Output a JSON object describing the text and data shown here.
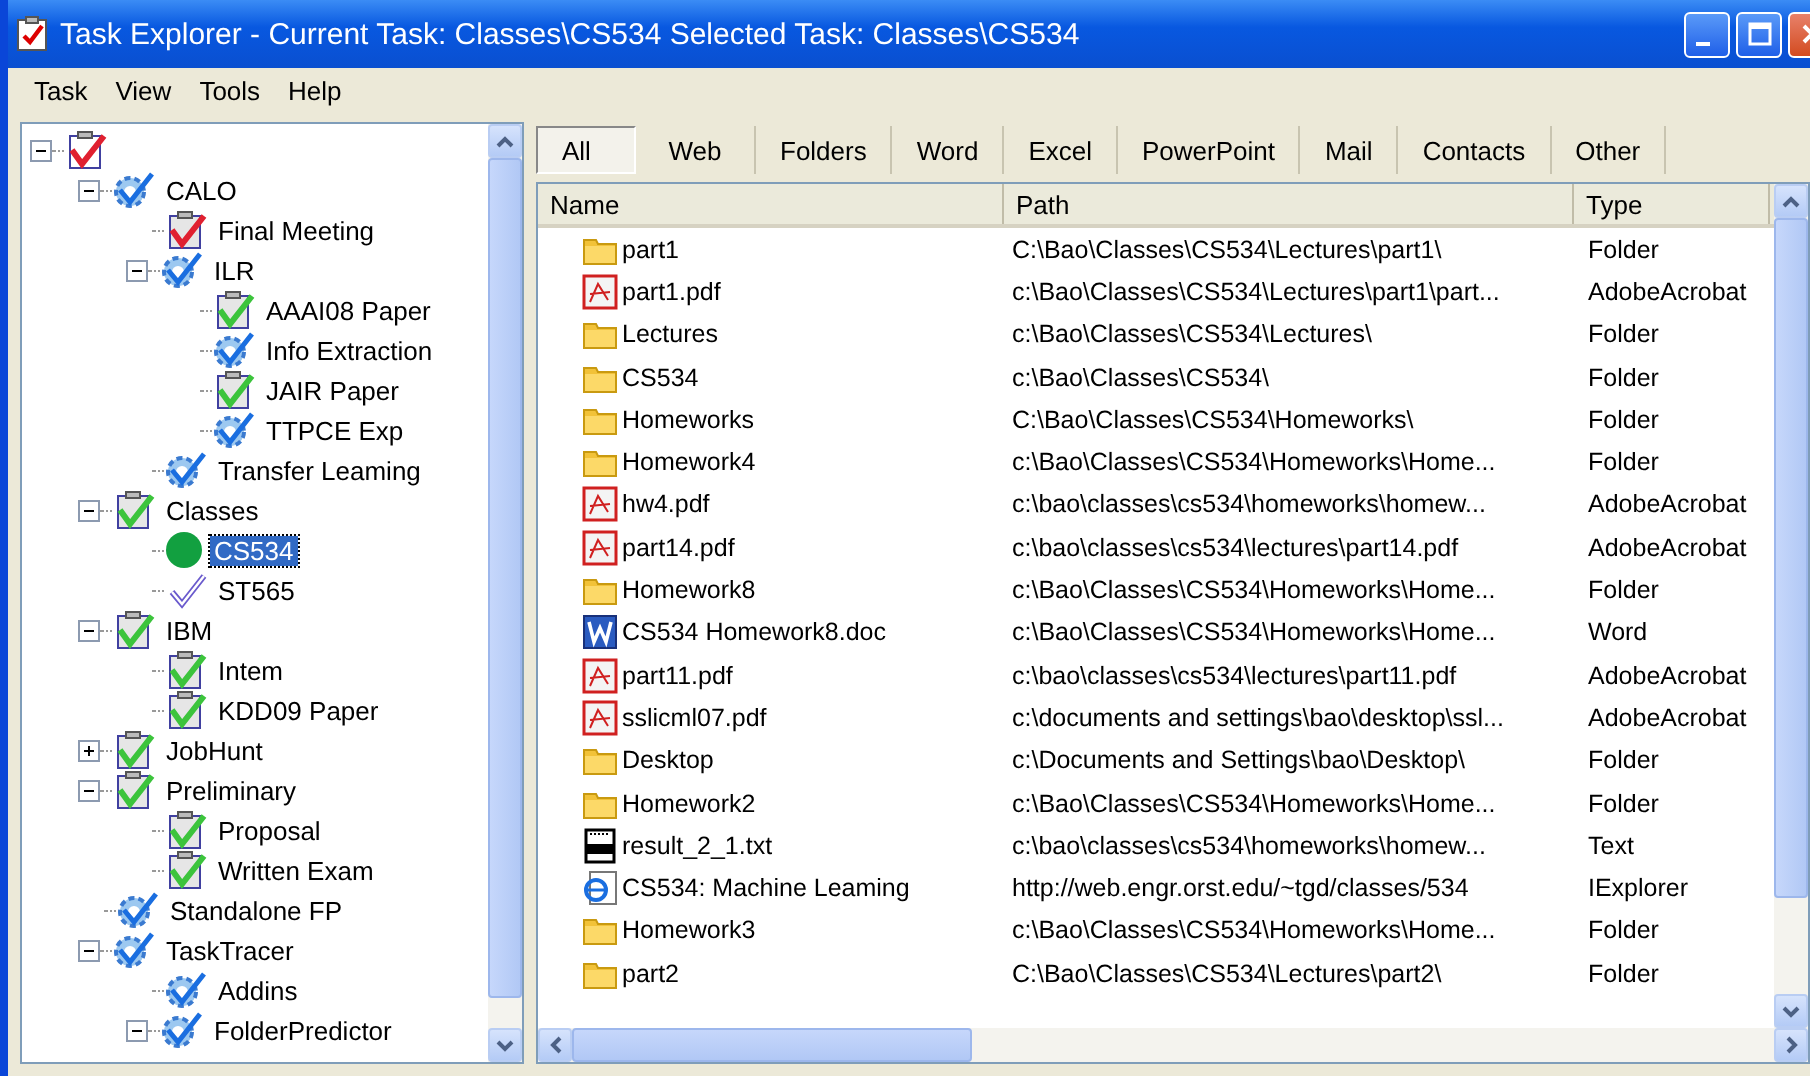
{
  "window": {
    "title": "Task Explorer - Current Task: Classes\\CS534  Selected Task: Classes\\CS534"
  },
  "menu": [
    "Task",
    "View",
    "Tools",
    "Help"
  ],
  "tree": [
    {
      "kind": "root",
      "expanded": true,
      "children": [
        {
          "label": "CALO",
          "kind": "gear",
          "expanded": true,
          "selected": false,
          "children": [
            {
              "label": "Final Meeting",
              "kind": "red-check",
              "selected": false
            },
            {
              "label": "ILR",
              "kind": "gear",
              "expanded": true,
              "selected": false,
              "children": [
                {
                  "label": "AAAI08 Paper",
                  "kind": "green-check",
                  "selected": false
                },
                {
                  "label": "Info Extraction",
                  "kind": "gear",
                  "selected": false
                },
                {
                  "label": "JAIR Paper",
                  "kind": "green-check",
                  "selected": false
                },
                {
                  "label": "TTPCE Exp",
                  "kind": "gear",
                  "selected": false
                }
              ]
            },
            {
              "label": "Transfer Leaming",
              "kind": "gear",
              "selected": false
            }
          ]
        },
        {
          "label": "Classes",
          "kind": "green-check",
          "expanded": true,
          "selected": false,
          "children": [
            {
              "label": "CS534",
              "kind": "dot",
              "selected": true
            },
            {
              "label": "ST565",
              "kind": "outline-check",
              "selected": false
            }
          ]
        },
        {
          "label": "IBM",
          "kind": "green-check",
          "expanded": true,
          "selected": false,
          "children": [
            {
              "label": "Intem",
              "kind": "green-check",
              "selected": false
            },
            {
              "label": "KDD09 Paper",
              "kind": "green-check",
              "selected": false
            }
          ]
        },
        {
          "label": "JobHunt",
          "kind": "green-check",
          "expanded": false,
          "selected": false
        },
        {
          "label": "Preliminary",
          "kind": "green-check",
          "expanded": true,
          "selected": false,
          "children": [
            {
              "label": "Proposal",
              "kind": "green-check",
              "selected": false
            },
            {
              "label": "Written Exam",
              "kind": "green-check",
              "selected": false
            }
          ]
        },
        {
          "label": "Standalone FP",
          "kind": "gear",
          "selected": false
        },
        {
          "label": "TaskTracer",
          "kind": "gear",
          "expanded": true,
          "selected": false,
          "children": [
            {
              "label": "Addins",
              "kind": "gear",
              "selected": false
            },
            {
              "label": "FolderPredictor",
              "kind": "gear",
              "expanded": true,
              "selected": false
            }
          ]
        }
      ]
    }
  ],
  "tabs": [
    {
      "label": "All",
      "selected": true
    },
    {
      "label": "Web",
      "selected": false
    },
    {
      "label": "Folders",
      "selected": false
    },
    {
      "label": "Word",
      "selected": false
    },
    {
      "label": "Excel",
      "selected": false
    },
    {
      "label": "PowerPoint",
      "selected": false
    },
    {
      "label": "Mail",
      "selected": false
    },
    {
      "label": "Contacts",
      "selected": false
    },
    {
      "label": "Other",
      "selected": false
    }
  ],
  "table": {
    "columns": [
      "Name",
      "Path",
      "Type"
    ],
    "rows": [
      {
        "kind": "folder",
        "name": "part1",
        "path": "C:\\Bao\\Classes\\CS534\\Lectures\\part1\\",
        "type": "Folder"
      },
      {
        "kind": "pdf",
        "name": "part1.pdf",
        "path": "c:\\Bao\\Classes\\CS534\\Lectures\\part1\\part...",
        "type": "AdobeAcrobat"
      },
      {
        "kind": "folder",
        "name": "Lectures",
        "path": "c:\\Bao\\Classes\\CS534\\Lectures\\",
        "type": "Folder"
      },
      {
        "kind": "folder",
        "name": "CS534",
        "path": "c:\\Bao\\Classes\\CS534\\",
        "type": "Folder"
      },
      {
        "kind": "folder",
        "name": "Homeworks",
        "path": "C:\\Bao\\Classes\\CS534\\Homeworks\\",
        "type": "Folder"
      },
      {
        "kind": "folder",
        "name": "Homework4",
        "path": "c:\\Bao\\Classes\\CS534\\Homeworks\\Home...",
        "type": "Folder"
      },
      {
        "kind": "pdf",
        "name": "hw4.pdf",
        "path": "c:\\bao\\classes\\cs534\\homeworks\\homew...",
        "type": "AdobeAcrobat"
      },
      {
        "kind": "pdf",
        "name": "part14.pdf",
        "path": "c:\\bao\\classes\\cs534\\lectures\\part14.pdf",
        "type": "AdobeAcrobat"
      },
      {
        "kind": "folder",
        "name": "Homework8",
        "path": "c:\\Bao\\Classes\\CS534\\Homeworks\\Home...",
        "type": "Folder"
      },
      {
        "kind": "word",
        "name": "CS534 Homework8.doc",
        "path": "c:\\Bao\\Classes\\CS534\\Homeworks\\Home...",
        "type": "Word"
      },
      {
        "kind": "pdf",
        "name": "part11.pdf",
        "path": "c:\\bao\\classes\\cs534\\lectures\\part11.pdf",
        "type": "AdobeAcrobat"
      },
      {
        "kind": "pdf",
        "name": "sslicml07.pdf",
        "path": "c:\\documents and settings\\bao\\desktop\\ssl...",
        "type": "AdobeAcrobat"
      },
      {
        "kind": "folder",
        "name": "Desktop",
        "path": "c:\\Documents and Settings\\bao\\Desktop\\",
        "type": "Folder"
      },
      {
        "kind": "folder",
        "name": "Homework2",
        "path": "c:\\Bao\\Classes\\CS534\\Homeworks\\Home...",
        "type": "Folder"
      },
      {
        "kind": "text",
        "name": "result_2_1.txt",
        "path": "c:\\bao\\classes\\cs534\\homeworks\\homew...",
        "type": "Text"
      },
      {
        "kind": "web",
        "name": "CS534: Machine Leaming",
        "path": "http://web.engr.orst.edu/~tgd/classes/534",
        "type": "IExplorer"
      },
      {
        "kind": "folder",
        "name": "Homework3",
        "path": "c:\\Bao\\Classes\\CS534\\Homeworks\\Home...",
        "type": "Folder"
      },
      {
        "kind": "folder",
        "name": "part2",
        "path": "C:\\Bao\\Classes\\CS534\\Lectures\\part2\\",
        "type": "Folder"
      }
    ]
  }
}
